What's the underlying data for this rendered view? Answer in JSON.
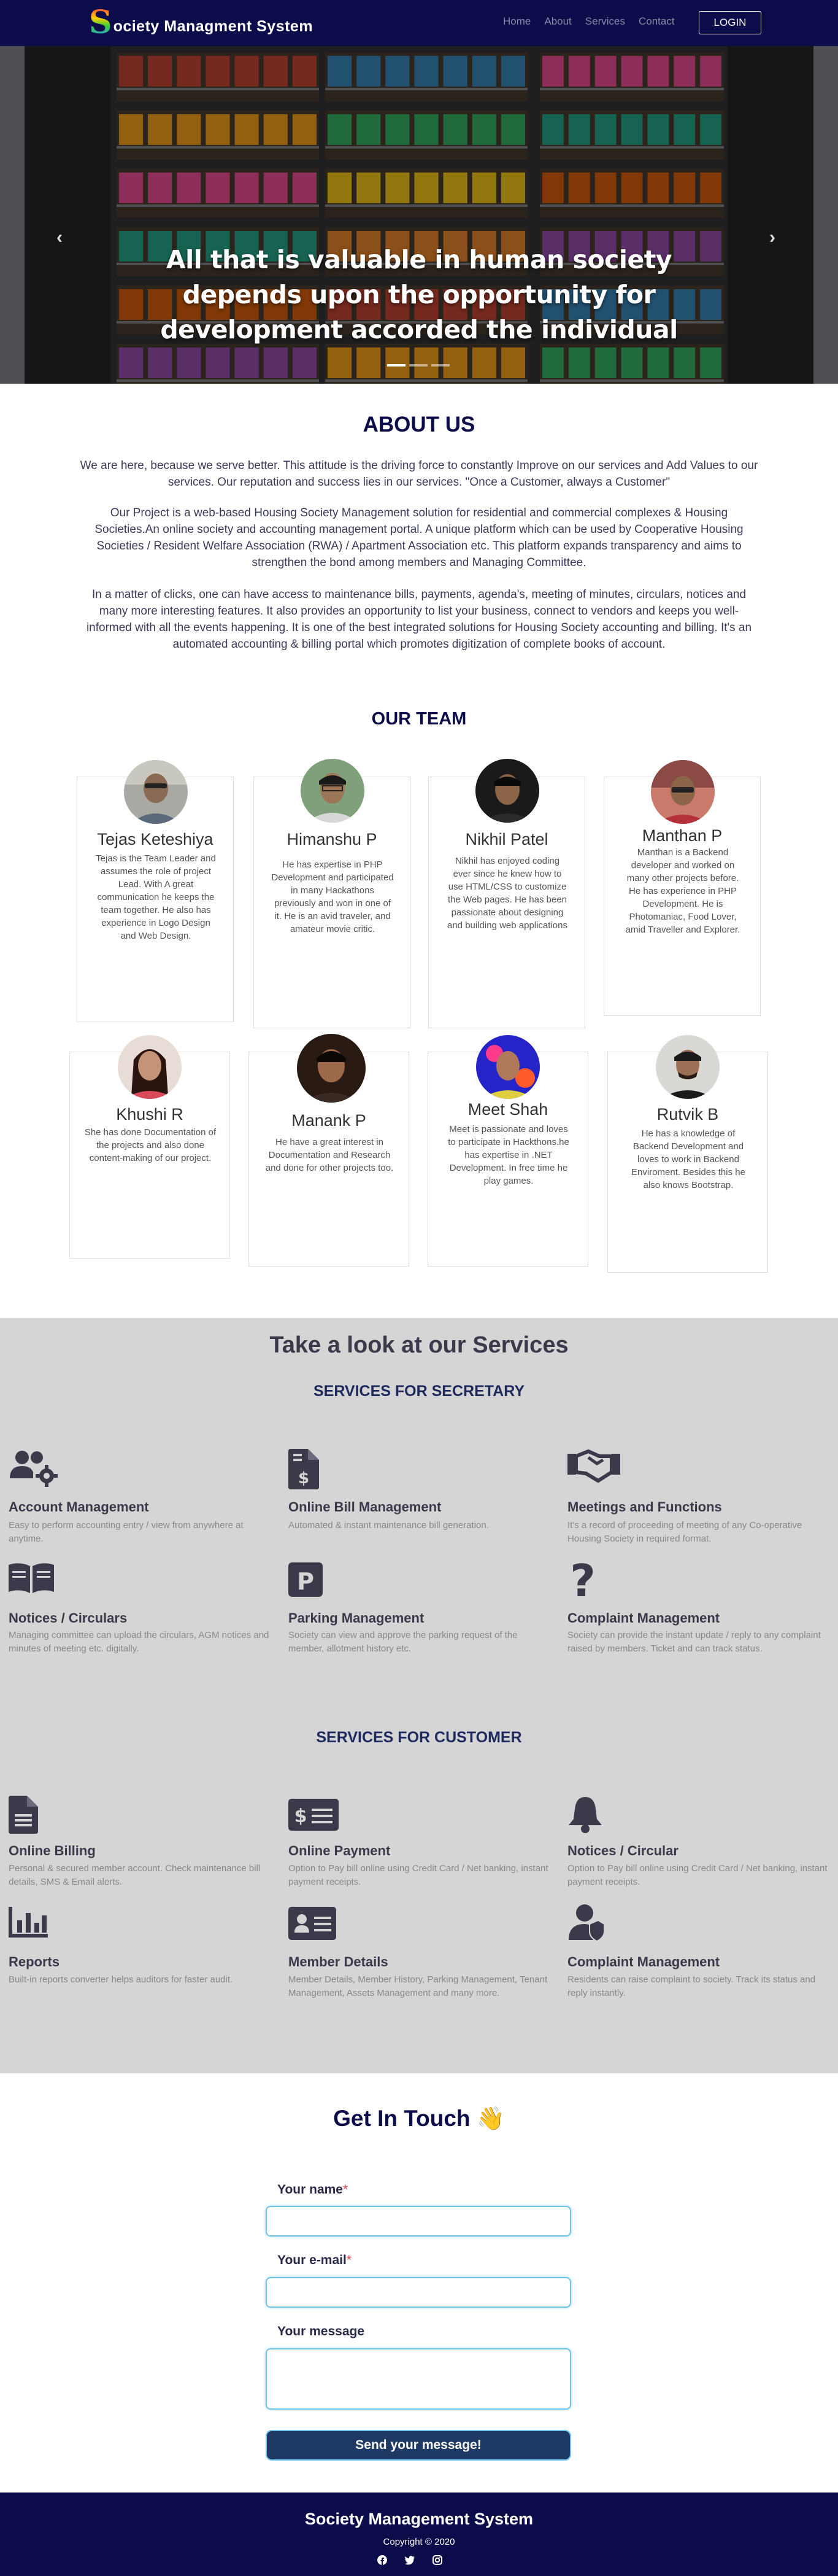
{
  "nav": {
    "brand_letter": "S",
    "brand_rest": "ociety Managment System",
    "links": [
      "Home",
      "About",
      "Services",
      "Contact"
    ],
    "login": "LOGIN"
  },
  "hero": {
    "caption": "All that is valuable in human society depends upon the opportunity for development accorded the individual",
    "prev": "‹",
    "next": "›",
    "slides": 3,
    "active_slide": 1
  },
  "about": {
    "title": "ABOUT US",
    "paragraphs": [
      "We are here, because we serve better. This attitude is the driving force to constantly Improve on our services and Add Values to our services. Our reputation and success lies in our services. \"Once a Customer, always a Customer\"",
      "Our Project is a web-based Housing Society Management solution for residential and commercial complexes & Housing Societies.An online society and accounting management portal. A unique platform which can be used by Cooperative Housing Societies / Resident Welfare Association (RWA) / Apartment Association etc. This platform expands transparency and aims to strengthen the bond among members and Managing Committee.",
      "In a matter of clicks, one can have access to maintenance bills, payments, agenda's, meeting of minutes, circulars, notices and many more interesting features. It also provides an opportunity to list your business, connect to vendors and keeps you well-informed with all the events happening. It is one of the best integrated solutions for Housing Society accounting and billing. It's an automated accounting & billing portal which promotes digitization of complete books of account."
    ]
  },
  "team": {
    "title": "OUR TEAM",
    "members": [
      {
        "name": "Tejas Keteshiya",
        "bio": "Tejas is the Team Leader and assumes the role of project Lead. With A great communication he keeps the team together. He also has experience in Logo Design and Web Design."
      },
      {
        "name": "Himanshu P",
        "bio": "He has expertise in PHP Development and participated in many Hackathons previously and won in one of it. He is an avid traveler, and amateur movie critic."
      },
      {
        "name": "Nikhil Patel",
        "bio": "Nikhil has enjoyed coding ever since he knew how to use HTML/CSS to customize the Web pages. He has been passionate about designing and building web applications"
      },
      {
        "name": "Manthan P",
        "bio": "Manthan is a Backend developer and worked on many other projects before. He has experience in PHP Development. He is Photomaniac, Food Lover, amid Traveller and Explorer."
      },
      {
        "name": "Khushi R",
        "bio": "She has done Documentation of the projects and also done content-making of our project."
      },
      {
        "name": "Manank P",
        "bio": "He have a great interest in Documentation and Research and done for other projects too."
      },
      {
        "name": "Meet Shah",
        "bio": "Meet is passionate and loves to participate in Hackthons.he has expertise in .NET Development. In free time he play games."
      },
      {
        "name": "Rutvik B",
        "bio": "He has a knowledge of Backend Development and loves to work in Backend Enviroment. Besides this he also knows Bootstrap."
      }
    ]
  },
  "services": {
    "title": "Take a look at our Services",
    "secretary_title": "SERVICES FOR SECRETARY",
    "secretary": [
      {
        "icon": "users-cog-icon",
        "title": "Account Management",
        "desc": "Easy to perform accounting entry / view from anywhere at anytime."
      },
      {
        "icon": "invoice-dollar-icon",
        "title": "Online Bill Management",
        "desc": "Automated & instant maintenance bill generation."
      },
      {
        "icon": "handshake-icon",
        "title": "Meetings and Functions",
        "desc": "It's a record of proceeding of meeting of any Co-operative Housing Society in required format."
      },
      {
        "icon": "book-open-icon",
        "title": "Notices / Circulars",
        "desc": "Managing committee can upload the circulars, AGM notices and minutes of meeting etc. digitally."
      },
      {
        "icon": "parking-icon",
        "title": "Parking Management",
        "desc": "Society can view and approve the parking request of the member, allotment history etc."
      },
      {
        "icon": "question-icon",
        "title": "Complaint Management",
        "desc": "Society can provide the instant update / reply to any complaint raised by members. Ticket and can track status."
      }
    ],
    "customer_title": "SERVICES FOR CUSTOMER",
    "customer": [
      {
        "icon": "file-alt-icon",
        "title": "Online Billing",
        "desc": "Personal & secured member account. Check maintenance bill details, SMS & Email alerts."
      },
      {
        "icon": "money-bill-icon",
        "title": "Online Payment",
        "desc": "Option to Pay bill online using Credit Card / Net banking, instant payment receipts."
      },
      {
        "icon": "bell-icon",
        "title": "Notices / Circular",
        "desc": "Option to Pay bill online using Credit Card / Net banking, instant payment receipts."
      },
      {
        "icon": "chart-bar-icon",
        "title": "Reports",
        "desc": "Built-in reports converter helps auditors for faster audit."
      },
      {
        "icon": "address-card-icon",
        "title": "Member Details",
        "desc": "Member Details, Member History, Parking Management, Tenant Management, Assets Management and many more."
      },
      {
        "icon": "user-shield-icon",
        "title": "Complaint Management",
        "desc": "Residents can raise complaint to society. Track its status and reply instantly."
      }
    ]
  },
  "contact": {
    "title": "Get In Touch",
    "emoji": "👋",
    "name_label": "Your name",
    "email_label": "Your e-mail",
    "message_label": "Your message",
    "required_mark": "*",
    "send": "Send your message!"
  },
  "footer": {
    "title": "Society Management System",
    "copyright": "Copyright © 2020",
    "social": [
      "facebook-icon",
      "twitter-icon",
      "instagram-icon"
    ]
  },
  "colors": {
    "nav_bg": "#0c0c4a",
    "services_bg": "#d5d5d5",
    "accent_field": "#6ec4ec",
    "send_btn": "#1e3a64",
    "icon": "#3a3a4a"
  }
}
